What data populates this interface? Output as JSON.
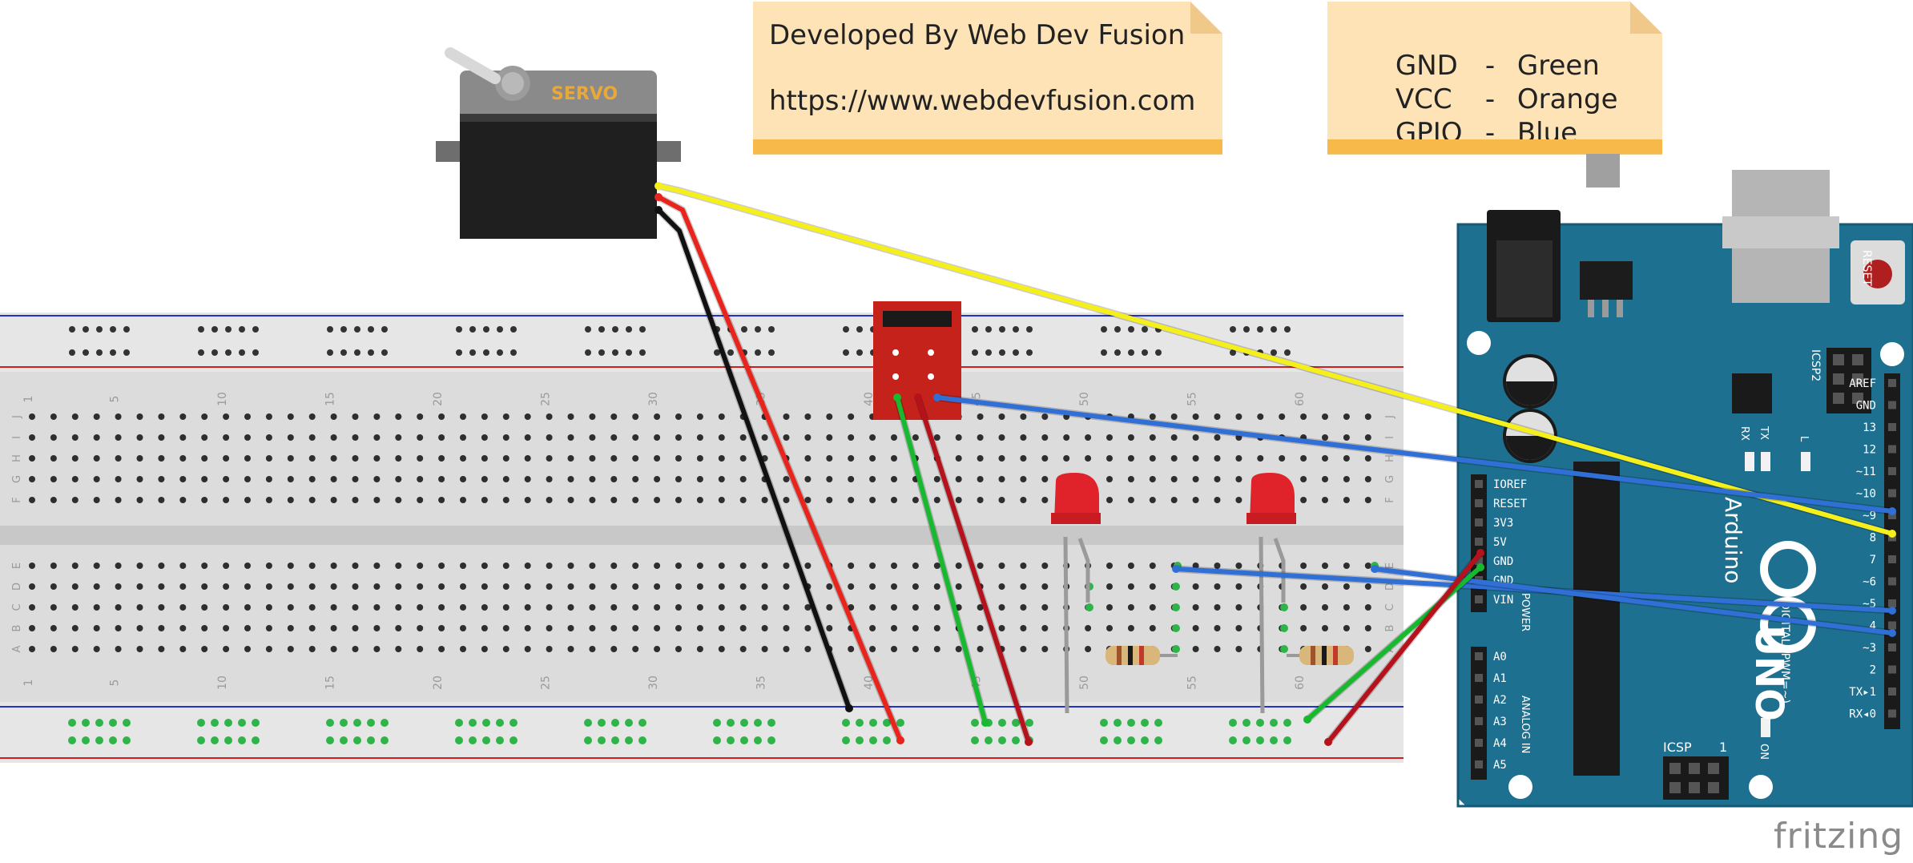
{
  "notes": {
    "credit": {
      "line1": "Developed By Web Dev Fusion",
      "line2": "https://www.webdevfusion.com"
    },
    "legend": {
      "rows": [
        {
          "name": "GND",
          "sep": "-",
          "color": "Green"
        },
        {
          "name": "VCC",
          "sep": "-",
          "color": "Orange"
        },
        {
          "name": "GPIO",
          "sep": "-",
          "color": "Blue"
        }
      ]
    }
  },
  "servo": {
    "label": "SERVO"
  },
  "breadboard": {
    "column_numbers": [
      "1",
      "5",
      "10",
      "15",
      "20",
      "25",
      "30",
      "35",
      "40",
      "45",
      "50",
      "55",
      "60"
    ],
    "row_letters_top": [
      "J",
      "I",
      "H",
      "G",
      "F"
    ],
    "row_letters_bottom": [
      "E",
      "D",
      "C",
      "B",
      "A"
    ]
  },
  "arduino": {
    "brand": "Arduino",
    "model": "UNO",
    "reset_label": "RESET",
    "icsp2_label": "ICSP2",
    "icsp_label": "ICSP",
    "icsp_pin1": "1",
    "rx_label": "RX",
    "tx_label": "TX",
    "l_label": "L",
    "on_label": "ON",
    "power_labels": [
      "IOREF",
      "RESET",
      "3V3",
      "5V",
      "GND",
      "GND",
      "VIN"
    ],
    "power_header": "POWER",
    "analog_labels": [
      "A0",
      "A1",
      "A2",
      "A3",
      "A4",
      "A5"
    ],
    "analog_header": "ANALOG IN",
    "digital_labels": [
      "AREF",
      "GND",
      "13",
      "12",
      "~11",
      "~10",
      "~9",
      "8",
      "7",
      "~6",
      "~5",
      "4",
      "~3",
      "2",
      "TX▸1",
      "RX◂0"
    ],
    "digital_header": "DIGITAL (PWM=~)"
  },
  "watermark": "fritzing",
  "wire_colors": {
    "yellow": "#f5ef1b",
    "red": "#e8241c",
    "black": "#111111",
    "green": "#18b82f",
    "dark_red": "#b5121b",
    "blue": "#2f6fd6"
  }
}
